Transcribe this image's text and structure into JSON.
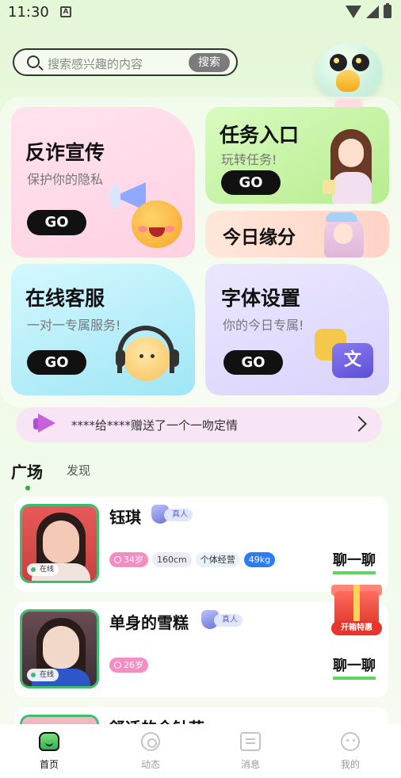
{
  "status_bar": {
    "time": "11:30",
    "a_icon": "A"
  },
  "search": {
    "placeholder": "搜索感兴趣的内容",
    "button": "搜索"
  },
  "cards": {
    "fanzha": {
      "title": "反诈宣传",
      "subtitle": "保护你的隐私",
      "button": "GO"
    },
    "renwu": {
      "title": "任务入口",
      "subtitle": "玩转任务!",
      "button": "GO"
    },
    "yuanfen": {
      "title": "今日缘分"
    },
    "kefu": {
      "title": "在线客服",
      "subtitle": "一对一专属服务!",
      "button": "GO"
    },
    "ziti": {
      "title": "字体设置",
      "subtitle": "你的今日专属!",
      "button": "GO"
    }
  },
  "notice": {
    "text": "****给****赠送了一个一吻定情"
  },
  "tabs": {
    "active": "广场",
    "inactive": "发现"
  },
  "users": [
    {
      "name": "钰琪",
      "verified": "真人",
      "online": "在线",
      "tags": {
        "age": "34岁",
        "height": "160cm",
        "job": "个体经营",
        "weight": "49kg"
      },
      "chat": "聊一聊"
    },
    {
      "name": "单身的雪糕",
      "verified": "真人",
      "online": "在线",
      "tags": {
        "age": "26岁"
      },
      "chat": "聊一聊"
    },
    {
      "name": "舒适的金针菇"
    }
  ],
  "gift_float": {
    "label": "开箱特惠"
  },
  "font_icon": "文",
  "bottom_nav": [
    {
      "label": "首页",
      "icon": "home-icon",
      "active": true
    },
    {
      "label": "动态",
      "icon": "dynamic-icon"
    },
    {
      "label": "消息",
      "icon": "message-icon"
    },
    {
      "label": "我的",
      "icon": "profile-icon"
    }
  ],
  "colors": {
    "accent_green": "#2fb24d",
    "verified_purple": "#6d75d6",
    "age_pink": "#f28ec4",
    "weight_blue": "#2d7cf6"
  }
}
